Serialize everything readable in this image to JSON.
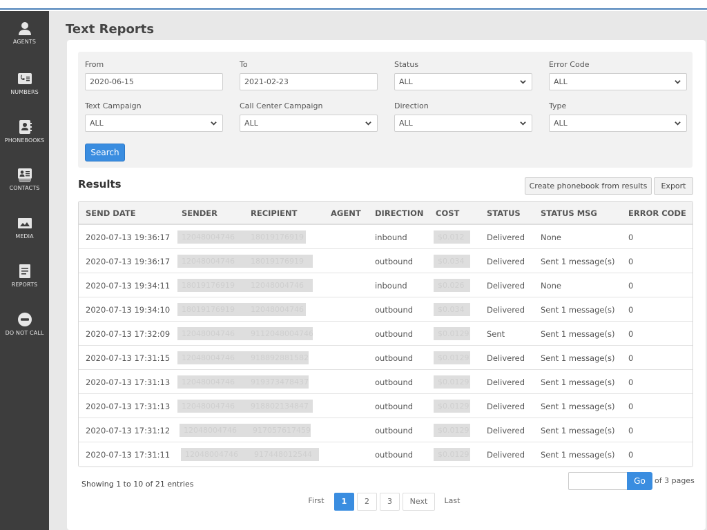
{
  "sidebar": {
    "items": [
      {
        "label": "AGENTS",
        "icon": "person-icon"
      },
      {
        "label": "NUMBERS",
        "icon": "phone-card-icon"
      },
      {
        "label": "PHONEBOOKS",
        "icon": "address-book-icon"
      },
      {
        "label": "CONTACTS",
        "icon": "contact-card-icon"
      },
      {
        "label": "MEDIA",
        "icon": "image-icon"
      },
      {
        "label": "REPORTS",
        "icon": "document-icon"
      },
      {
        "label": "DO NOT CALL",
        "icon": "no-entry-icon"
      }
    ]
  },
  "page": {
    "title": "Text Reports"
  },
  "filters": {
    "from": {
      "label": "From",
      "value": "2020-06-15"
    },
    "to": {
      "label": "To",
      "value": "2021-02-23"
    },
    "status": {
      "label": "Status",
      "value": "ALL"
    },
    "error_code": {
      "label": "Error Code",
      "value": "ALL"
    },
    "text_campaign": {
      "label": "Text Campaign",
      "value": "ALL"
    },
    "call_center_campaign": {
      "label": "Call Center Campaign",
      "value": "ALL"
    },
    "direction": {
      "label": "Direction",
      "value": "ALL"
    },
    "type": {
      "label": "Type",
      "value": "ALL"
    },
    "search_label": "Search"
  },
  "results": {
    "title": "Results",
    "create_phonebook_label": "Create phonebook from results",
    "export_label": "Export",
    "columns": [
      "SEND DATE",
      "SENDER",
      "RECIPIENT",
      "AGENT",
      "DIRECTION",
      "COST",
      "STATUS",
      "STATUS MSG",
      "ERROR CODE"
    ],
    "rows": [
      {
        "send_date": "2020-07-13 19:36:17",
        "sender": "12048004746",
        "recipient": "18019176919",
        "agent": "",
        "direction": "inbound",
        "cost": "$0.012",
        "status": "Delivered",
        "status_msg": "None",
        "error_code": "0"
      },
      {
        "send_date": "2020-07-13 19:36:17",
        "sender": "12048004746",
        "recipient": "18019176919",
        "agent": "",
        "direction": "outbound",
        "cost": "$0.034",
        "status": "Delivered",
        "status_msg": "Sent 1 message(s)",
        "error_code": "0"
      },
      {
        "send_date": "2020-07-13 19:34:11",
        "sender": "18019176919",
        "recipient": "12048004746",
        "agent": "",
        "direction": "inbound",
        "cost": "$0.026",
        "status": "Delivered",
        "status_msg": "None",
        "error_code": "0"
      },
      {
        "send_date": "2020-07-13 19:34:10",
        "sender": "18019176919",
        "recipient": "12048004746",
        "agent": "",
        "direction": "outbound",
        "cost": "$0.034",
        "status": "Delivered",
        "status_msg": "Sent 1 message(s)",
        "error_code": "0"
      },
      {
        "send_date": "2020-07-13 17:32:09",
        "sender": "12048004746",
        "recipient": "9112048004746",
        "agent": "",
        "direction": "outbound",
        "cost": "$0.01291",
        "status": "Sent",
        "status_msg": "Sent 1 message(s)",
        "error_code": "0"
      },
      {
        "send_date": "2020-07-13 17:31:15",
        "sender": "12048004746",
        "recipient": "918892881582",
        "agent": "",
        "direction": "outbound",
        "cost": "$0.01291",
        "status": "Delivered",
        "status_msg": "Sent 1 message(s)",
        "error_code": "0"
      },
      {
        "send_date": "2020-07-13 17:31:13",
        "sender": "12048004746",
        "recipient": "919373478437",
        "agent": "",
        "direction": "outbound",
        "cost": "$0.01291",
        "status": "Delivered",
        "status_msg": "Sent 1 message(s)",
        "error_code": "0"
      },
      {
        "send_date": "2020-07-13 17:31:13",
        "sender": "12048004746",
        "recipient": "918802134847",
        "agent": "",
        "direction": "outbound",
        "cost": "$0.01291",
        "status": "Delivered",
        "status_msg": "Sent 1 message(s)",
        "error_code": "0"
      },
      {
        "send_date": "2020-07-13 17:31:12",
        "sender": "12048004746",
        "recipient": "917057617459",
        "agent": "",
        "direction": "outbound",
        "cost": "$0.01291",
        "status": "Delivered",
        "status_msg": "Sent 1 message(s)",
        "error_code": "0"
      },
      {
        "send_date": "2020-07-13 17:31:11",
        "sender": "12048004746",
        "recipient": "917448012544",
        "agent": "",
        "direction": "outbound",
        "cost": "$0.01291",
        "status": "Delivered",
        "status_msg": "Sent 1 message(s)",
        "error_code": "0"
      }
    ]
  },
  "pagination": {
    "info": "Showing 1 to 10 of 21 entries",
    "goto_value": "",
    "go_label": "Go",
    "of_pages": "of 3 pages",
    "first_label": "First",
    "pages": [
      "1",
      "2",
      "3"
    ],
    "current_page": "1",
    "next_label": "Next",
    "last_label": "Last"
  },
  "colors": {
    "sidebar_bg": "#3d3d3d",
    "accent": "#3a8de0",
    "top_border": "#4a80b8"
  }
}
